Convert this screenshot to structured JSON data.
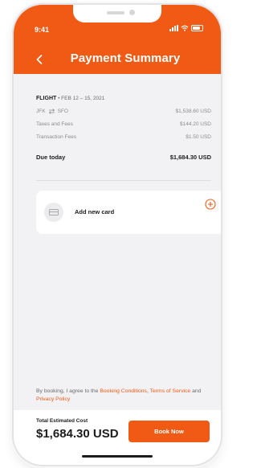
{
  "status": {
    "time": "9:41"
  },
  "header": {
    "title": "Payment Summary"
  },
  "summary": {
    "flight_label": "FLIGHT",
    "flight_dates": "• FEB 12 – 15, 2021",
    "route_from": "JFK",
    "route_to": "SFO",
    "route_price": "$1,538.60 USD",
    "taxes_label": "Taxes and Fees",
    "taxes_value": "$144.20 USD",
    "transaction_label": "Transaction Fees",
    "transaction_value": "$1.50 USD",
    "due_label": "Due today",
    "due_value": "$1,684.30 USD"
  },
  "card": {
    "label": "Add new card"
  },
  "terms": {
    "prefix": "By booking, I agree to the ",
    "booking_conditions": "Booking Conditions",
    "comma": ", ",
    "terms_of_service": "Terms of Service",
    "and": " and ",
    "privacy_policy": "Privacy Policy"
  },
  "footer": {
    "total_label": "Total Estimated Cost",
    "total_value": "$1,684.30 USD",
    "book_label": "Book Now"
  },
  "colors": {
    "accent": "#f15a14",
    "text_dark": "#1c1c1e",
    "text_muted": "#8b8b90",
    "background": "#f2f2f4"
  },
  "icons": [
    "back-icon",
    "signal-icon",
    "wifi-icon",
    "battery-icon",
    "swap-icon",
    "card-icon",
    "add-circle-icon"
  ]
}
